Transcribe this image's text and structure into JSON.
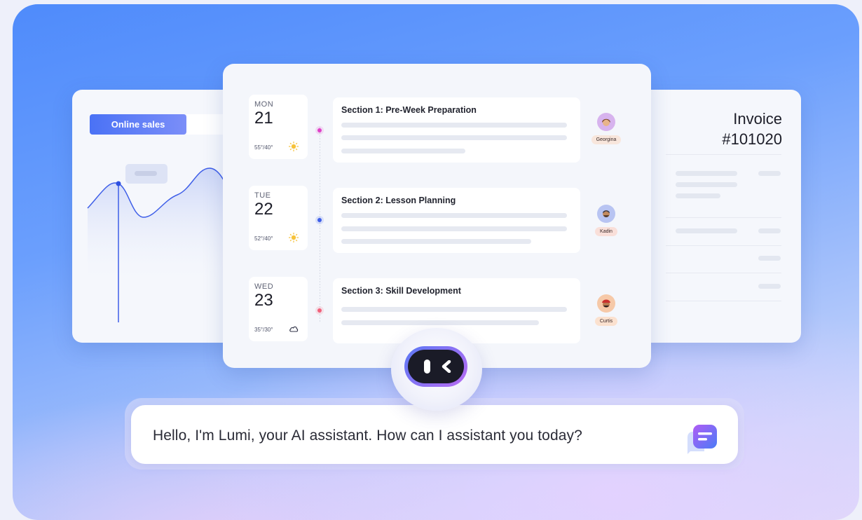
{
  "sales": {
    "tab_label": "Online sales"
  },
  "invoice": {
    "title_line1": "Invoice",
    "title_line2": "#101020"
  },
  "schedule": {
    "days": [
      {
        "name": "MON",
        "number": "21",
        "temp": "55°/40°",
        "weather": "sun-icon",
        "section_title": "Section 1: Pre-Week Preparation",
        "person": "Georgina",
        "dot_color": "#e040c8"
      },
      {
        "name": "TUE",
        "number": "22",
        "temp": "52°/40°",
        "weather": "sun-icon",
        "section_title": "Section 2: Lesson Planning",
        "person": "Kadin",
        "dot_color": "#3d5ee8"
      },
      {
        "name": "WED",
        "number": "23",
        "temp": "35°/30°",
        "weather": "cloud-icon",
        "section_title": "Section 3: Skill Development",
        "person": "Curtis",
        "dot_color": "#f2607a"
      }
    ]
  },
  "assistant": {
    "message": "Hello, I'm Lumi, your AI assistant. How can I assistant you today?",
    "icon": "chat-bubble-icon"
  },
  "colors": {
    "accent": "#4a72f5",
    "assistant_gradient_start": "#5a78f5",
    "assistant_gradient_end": "#b86bf2"
  }
}
